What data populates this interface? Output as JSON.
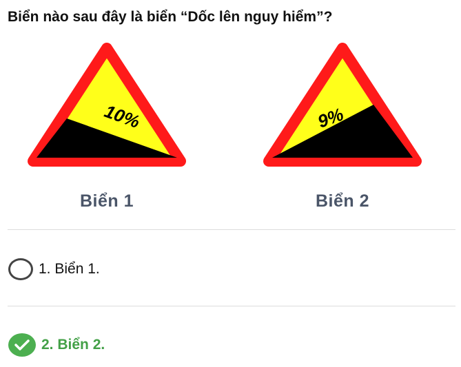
{
  "question": "Biển nào sau đây là biển “Dốc lên nguy hiểm”?",
  "signs": [
    {
      "caption": "Biển 1",
      "grade": "10%"
    },
    {
      "caption": "Biển 2",
      "grade": "9%"
    }
  ],
  "options": [
    {
      "label": "1. Biển 1.",
      "state": "unselected"
    },
    {
      "label": "2. Biển 2.",
      "state": "correct"
    }
  ],
  "colors": {
    "sign_border": "#ff1a1a",
    "sign_fill": "#ffff1a",
    "slope": "#000000",
    "caption": "#4a5568",
    "correct": "#4caf50",
    "correct_text": "#43a047"
  }
}
